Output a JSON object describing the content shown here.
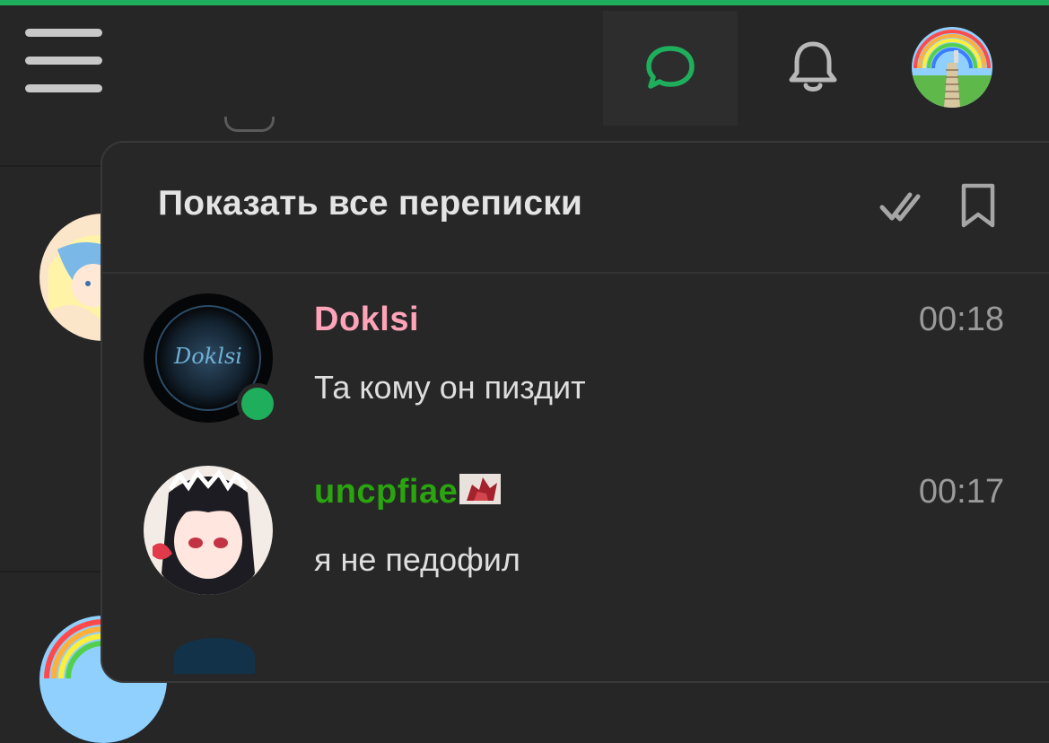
{
  "header": {
    "menu_icon": "hamburger-menu-icon",
    "messages_icon": "chat-bubble-icon",
    "notifications_icon": "bell-icon",
    "avatar": "user-avatar"
  },
  "colors": {
    "accent": "#1fae5b",
    "background": "#262626",
    "panel": "#272727",
    "name_pink": "#ffa3b8",
    "name_green": "#2aa40f",
    "time": "#9a9a9a"
  },
  "panel": {
    "title": "Показать все переписки",
    "mark_read_icon": "double-check-icon",
    "bookmark_icon": "bookmark-icon"
  },
  "conversations": [
    {
      "name": "Doklsi",
      "name_color": "#ffa3b8",
      "time": "00:18",
      "message": "Та кому он пиздит",
      "avatar_text": "Doklsi",
      "online": true
    },
    {
      "name": "uncpfiae",
      "name_color": "#2aa40f",
      "time": "00:17",
      "message": "я не педофил",
      "online": false
    }
  ]
}
